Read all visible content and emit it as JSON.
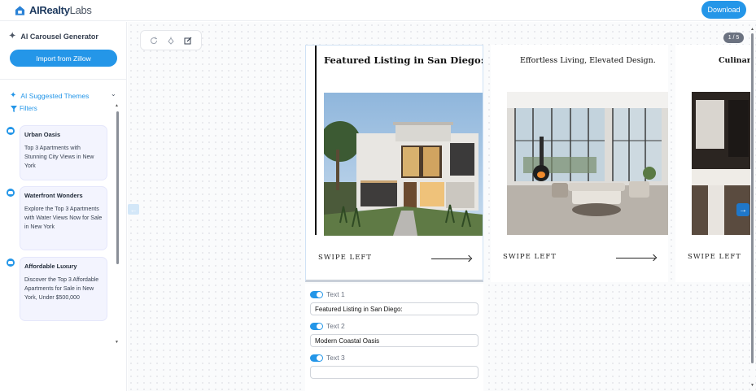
{
  "header": {
    "brand_bold": "AI",
    "brand_mid": "Realty",
    "brand_light": "Labs",
    "download_label": "Download"
  },
  "sidebar": {
    "generator_title": "AI Carousel Generator",
    "import_label": "Import from Zillow",
    "themes_label": "AI Suggested Themes",
    "filters_label": "Filters",
    "themes": [
      {
        "title": "Urban Oasis",
        "description": "Top 3 Apartments with Stunning City Views in New York"
      },
      {
        "title": "Waterfront Wonders",
        "description": "Explore the Top 3 Apartments with Water Views Now for Sale in New York"
      },
      {
        "title": "Affordable Luxury",
        "description": "Discover the Top 3 Affordable Apartments for Sale in New York, Under $500,000"
      }
    ]
  },
  "canvas": {
    "page_counter": "1 / 5",
    "slides": [
      {
        "heading": "Featured Listing in San Diego:",
        "swipe": "SWIPE LEFT"
      },
      {
        "heading": "Effortless Living, Elevated Design.",
        "swipe": "SWIPE LEFT"
      },
      {
        "heading": "Culinary",
        "swipe": "SWIPE LEFT"
      }
    ]
  },
  "text_panel": {
    "fields": [
      {
        "label": "Text 1",
        "value": "Featured Listing in San Diego:"
      },
      {
        "label": "Text 2",
        "value": "Modern Coastal Oasis"
      },
      {
        "label": "Text 3",
        "value": ""
      }
    ]
  },
  "colors": {
    "accent": "#2496e8",
    "arrow_blue": "#1f77c9"
  }
}
